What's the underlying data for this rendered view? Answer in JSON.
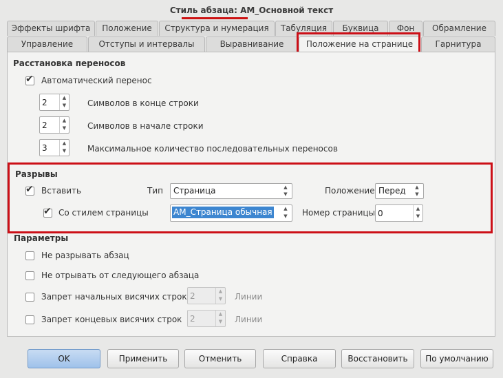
{
  "window": {
    "title": "Стиль абзаца: АМ_Основной текст"
  },
  "tabs_row1": [
    "Эффекты шрифта",
    "Положение",
    "Структура и нумерация",
    "Табуляция",
    "Буквица",
    "Фон",
    "Обрамление"
  ],
  "tabs_row2": [
    "Управление",
    "Отступы и интервалы",
    "Выравнивание",
    "Положение на странице",
    "Гарнитура"
  ],
  "active_tab": "Положение на странице",
  "hyphenation": {
    "title": "Расстановка переносов",
    "auto_label": "Автоматический перенос",
    "auto_checked": true,
    "end_chars_value": "2",
    "end_chars_label": "Символов в конце строки",
    "start_chars_value": "2",
    "start_chars_label": "Символов в начале строки",
    "max_consecutive_value": "3",
    "max_consecutive_label": "Максимальное количество последовательных переносов"
  },
  "breaks": {
    "title": "Разрывы",
    "insert_label": "Вставить",
    "insert_checked": true,
    "type_label": "Тип",
    "type_value": "Страница",
    "position_label": "Положение",
    "position_value": "Перед",
    "with_style_label": "Со стилем страницы",
    "with_style_checked": true,
    "page_style_value": "АМ_Страница обычная",
    "page_number_label": "Номер страницы",
    "page_number_value": "0"
  },
  "options": {
    "title": "Параметры",
    "no_split_label": "Не разрывать абзац",
    "no_split_checked": false,
    "keep_next_label": "Не отрывать от следующего абзаца",
    "keep_next_checked": false,
    "orphan_label": "Запрет начальных висячих строк",
    "orphan_checked": false,
    "orphan_value": "2",
    "orphan_unit": "Линии",
    "widow_label": "Запрет концевых висячих строк",
    "widow_checked": false,
    "widow_value": "2",
    "widow_unit": "Линии"
  },
  "buttons": {
    "ok": "OK",
    "apply": "Применить",
    "cancel": "Отменить",
    "help": "Справка",
    "reset": "Восстановить",
    "default": "По умолчанию"
  },
  "colors": {
    "highlight_red": "#cc0f17",
    "selection_blue": "#3d86d0"
  }
}
